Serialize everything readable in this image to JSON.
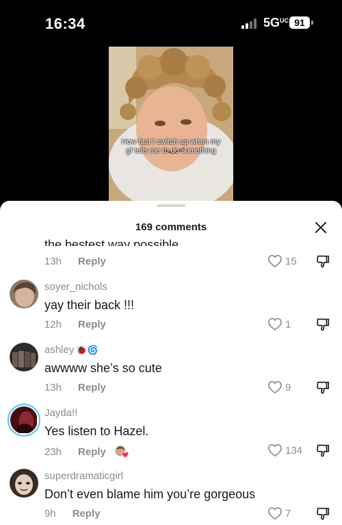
{
  "status_bar": {
    "time": "16:34",
    "network": "5G",
    "network_sub": "UC",
    "battery": "91"
  },
  "video": {
    "caption": "How fast I switch up when my gf tells me to do something"
  },
  "sheet": {
    "title": "169 comments",
    "truncated_comment": "the bestest way possible"
  },
  "comments": [
    {
      "time": "13h",
      "reply_label": "Reply",
      "likes": "15"
    },
    {
      "username": "soyer_nichols",
      "text": "yay their back !!!",
      "time": "12h",
      "reply_label": "Reply",
      "likes": "1"
    },
    {
      "username": "ashley",
      "username_emojis": "🐞🌀",
      "text": "awwww she’s so cute",
      "time": "13h",
      "reply_label": "Reply",
      "likes": "9"
    },
    {
      "username": "Jayda!!",
      "text": "Yes listen to Hazel.",
      "time": "23h",
      "reply_label": "Reply",
      "likes": "134"
    },
    {
      "username": "superdramaticgirl",
      "text": "Don’t even blame him you’re gorgeous",
      "time": "9h",
      "reply_label": "Reply",
      "likes": "7"
    }
  ],
  "colors": {
    "sheet_bg": "#ffffff",
    "text_primary": "#161823",
    "text_secondary": "#8a8b91",
    "story_ring": "#53c5e8",
    "creator_heart": "#fe2c55"
  },
  "icons": [
    "signal-icon",
    "battery-icon",
    "close-icon",
    "heart-outline-icon",
    "dislike-icon",
    "creator-liked-icon"
  ]
}
